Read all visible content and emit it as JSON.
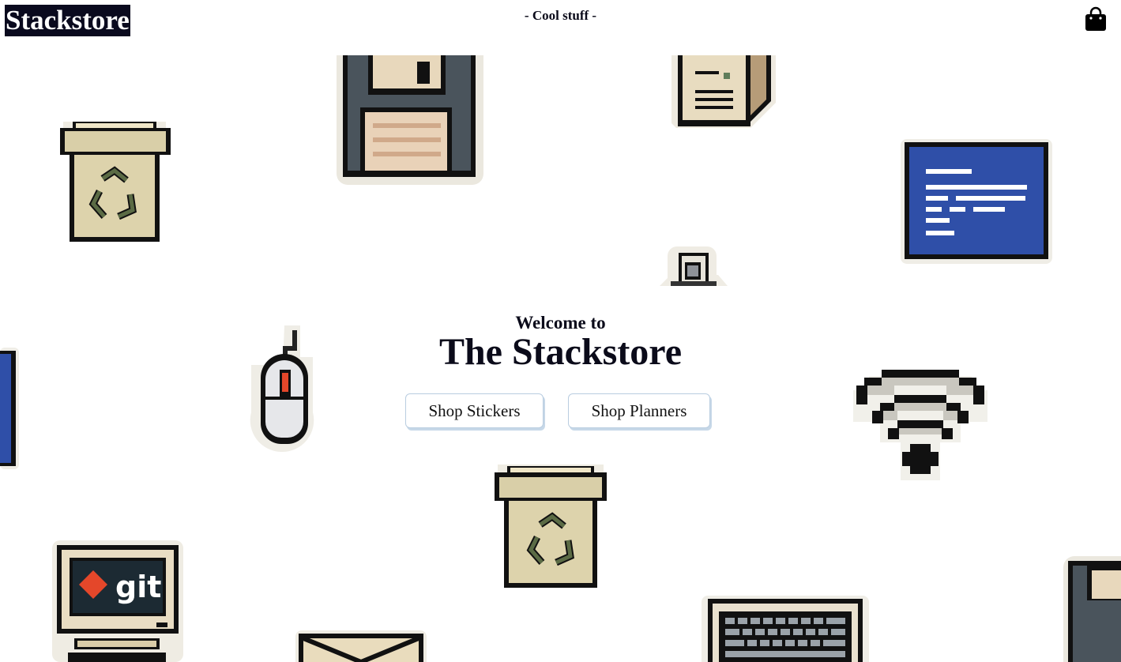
{
  "header": {
    "logo": "Stackstore",
    "tagline": "- Cool stuff -",
    "cart_icon": "shopping-bag-icon"
  },
  "hero": {
    "welcome": "Welcome to",
    "title": "The Stackstore",
    "buttons": [
      {
        "label": "Shop Stickers"
      },
      {
        "label": "Shop Planners"
      }
    ]
  },
  "stickers": [
    {
      "name": "recycle-bin-sticker"
    },
    {
      "name": "floppy-disk-sticker"
    },
    {
      "name": "computer-tower-sticker"
    },
    {
      "name": "blue-screen-monitor-sticker"
    },
    {
      "name": "usb-drive-sticker"
    },
    {
      "name": "blue-monitor-edge-sticker"
    },
    {
      "name": "computer-mouse-sticker"
    },
    {
      "name": "wifi-signal-sticker"
    },
    {
      "name": "recycle-bin-sticker"
    },
    {
      "name": "git-computer-sticker",
      "text": "git"
    },
    {
      "name": "envelope-sticker"
    },
    {
      "name": "keyboard-sticker"
    },
    {
      "name": "floppy-disk-edge-sticker"
    }
  ],
  "colors": {
    "logo_bg": "#0a0a1e",
    "button_border": "#b9cde0",
    "sticker_blue": "#2f4fa8",
    "git_red": "#e4472a"
  }
}
